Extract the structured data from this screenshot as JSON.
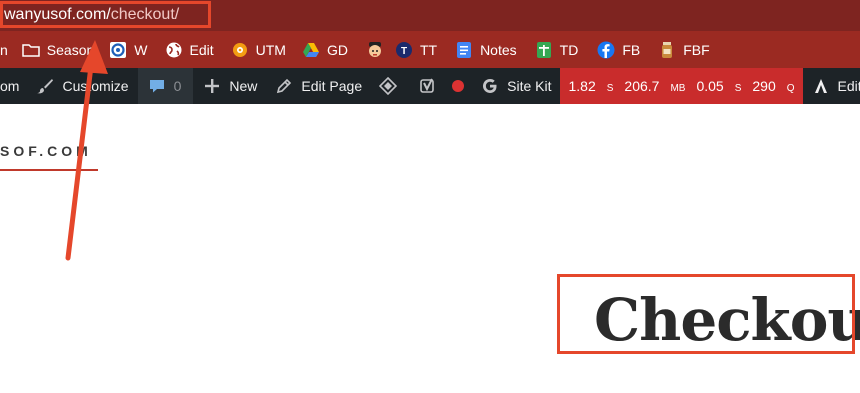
{
  "browser": {
    "url_domain": "wanyusof.com/",
    "url_path": "checkout/"
  },
  "bookmarks": [
    {
      "label": "n",
      "icon": "none"
    },
    {
      "label": "Season",
      "icon": "folder-icon"
    },
    {
      "label": "W",
      "icon": "w-badge-icon"
    },
    {
      "label": "Edit",
      "icon": "globe-icon"
    },
    {
      "label": "UTM",
      "icon": "utm-gear-icon"
    },
    {
      "label": "GD",
      "icon": "google-drive-icon"
    },
    {
      "label": "",
      "icon": "character-icon"
    },
    {
      "label": "TT",
      "icon": "tt-badge-icon"
    },
    {
      "label": "Notes",
      "icon": "google-docs-icon"
    },
    {
      "label": "TD",
      "icon": "google-sheets-icon"
    },
    {
      "label": "FB",
      "icon": "facebook-icon"
    },
    {
      "label": "FBF",
      "icon": "jar-icon"
    }
  ],
  "admin_bar": {
    "site_partial": "om",
    "customize": "Customize",
    "comments_count": "0",
    "new": "New",
    "edit_page": "Edit Page",
    "site_kit": "Site Kit",
    "perf": {
      "time": "1.82",
      "time_unit": "S",
      "memory": "206.7",
      "memory_unit": "MB",
      "query_time": "0.05",
      "query_time_unit": "S",
      "queries": "290",
      "queries_unit": "Q"
    },
    "edit_with": "Edit with T"
  },
  "site": {
    "logo_partial": "SOF.COM"
  },
  "page": {
    "title": "Checkout"
  },
  "colors": {
    "url_bar": "#7e2420",
    "bookmarks_bar": "#9b2a22",
    "admin_bar": "#1d2327",
    "perf_bg": "#c92c2c",
    "annotation": "#e5472b"
  }
}
